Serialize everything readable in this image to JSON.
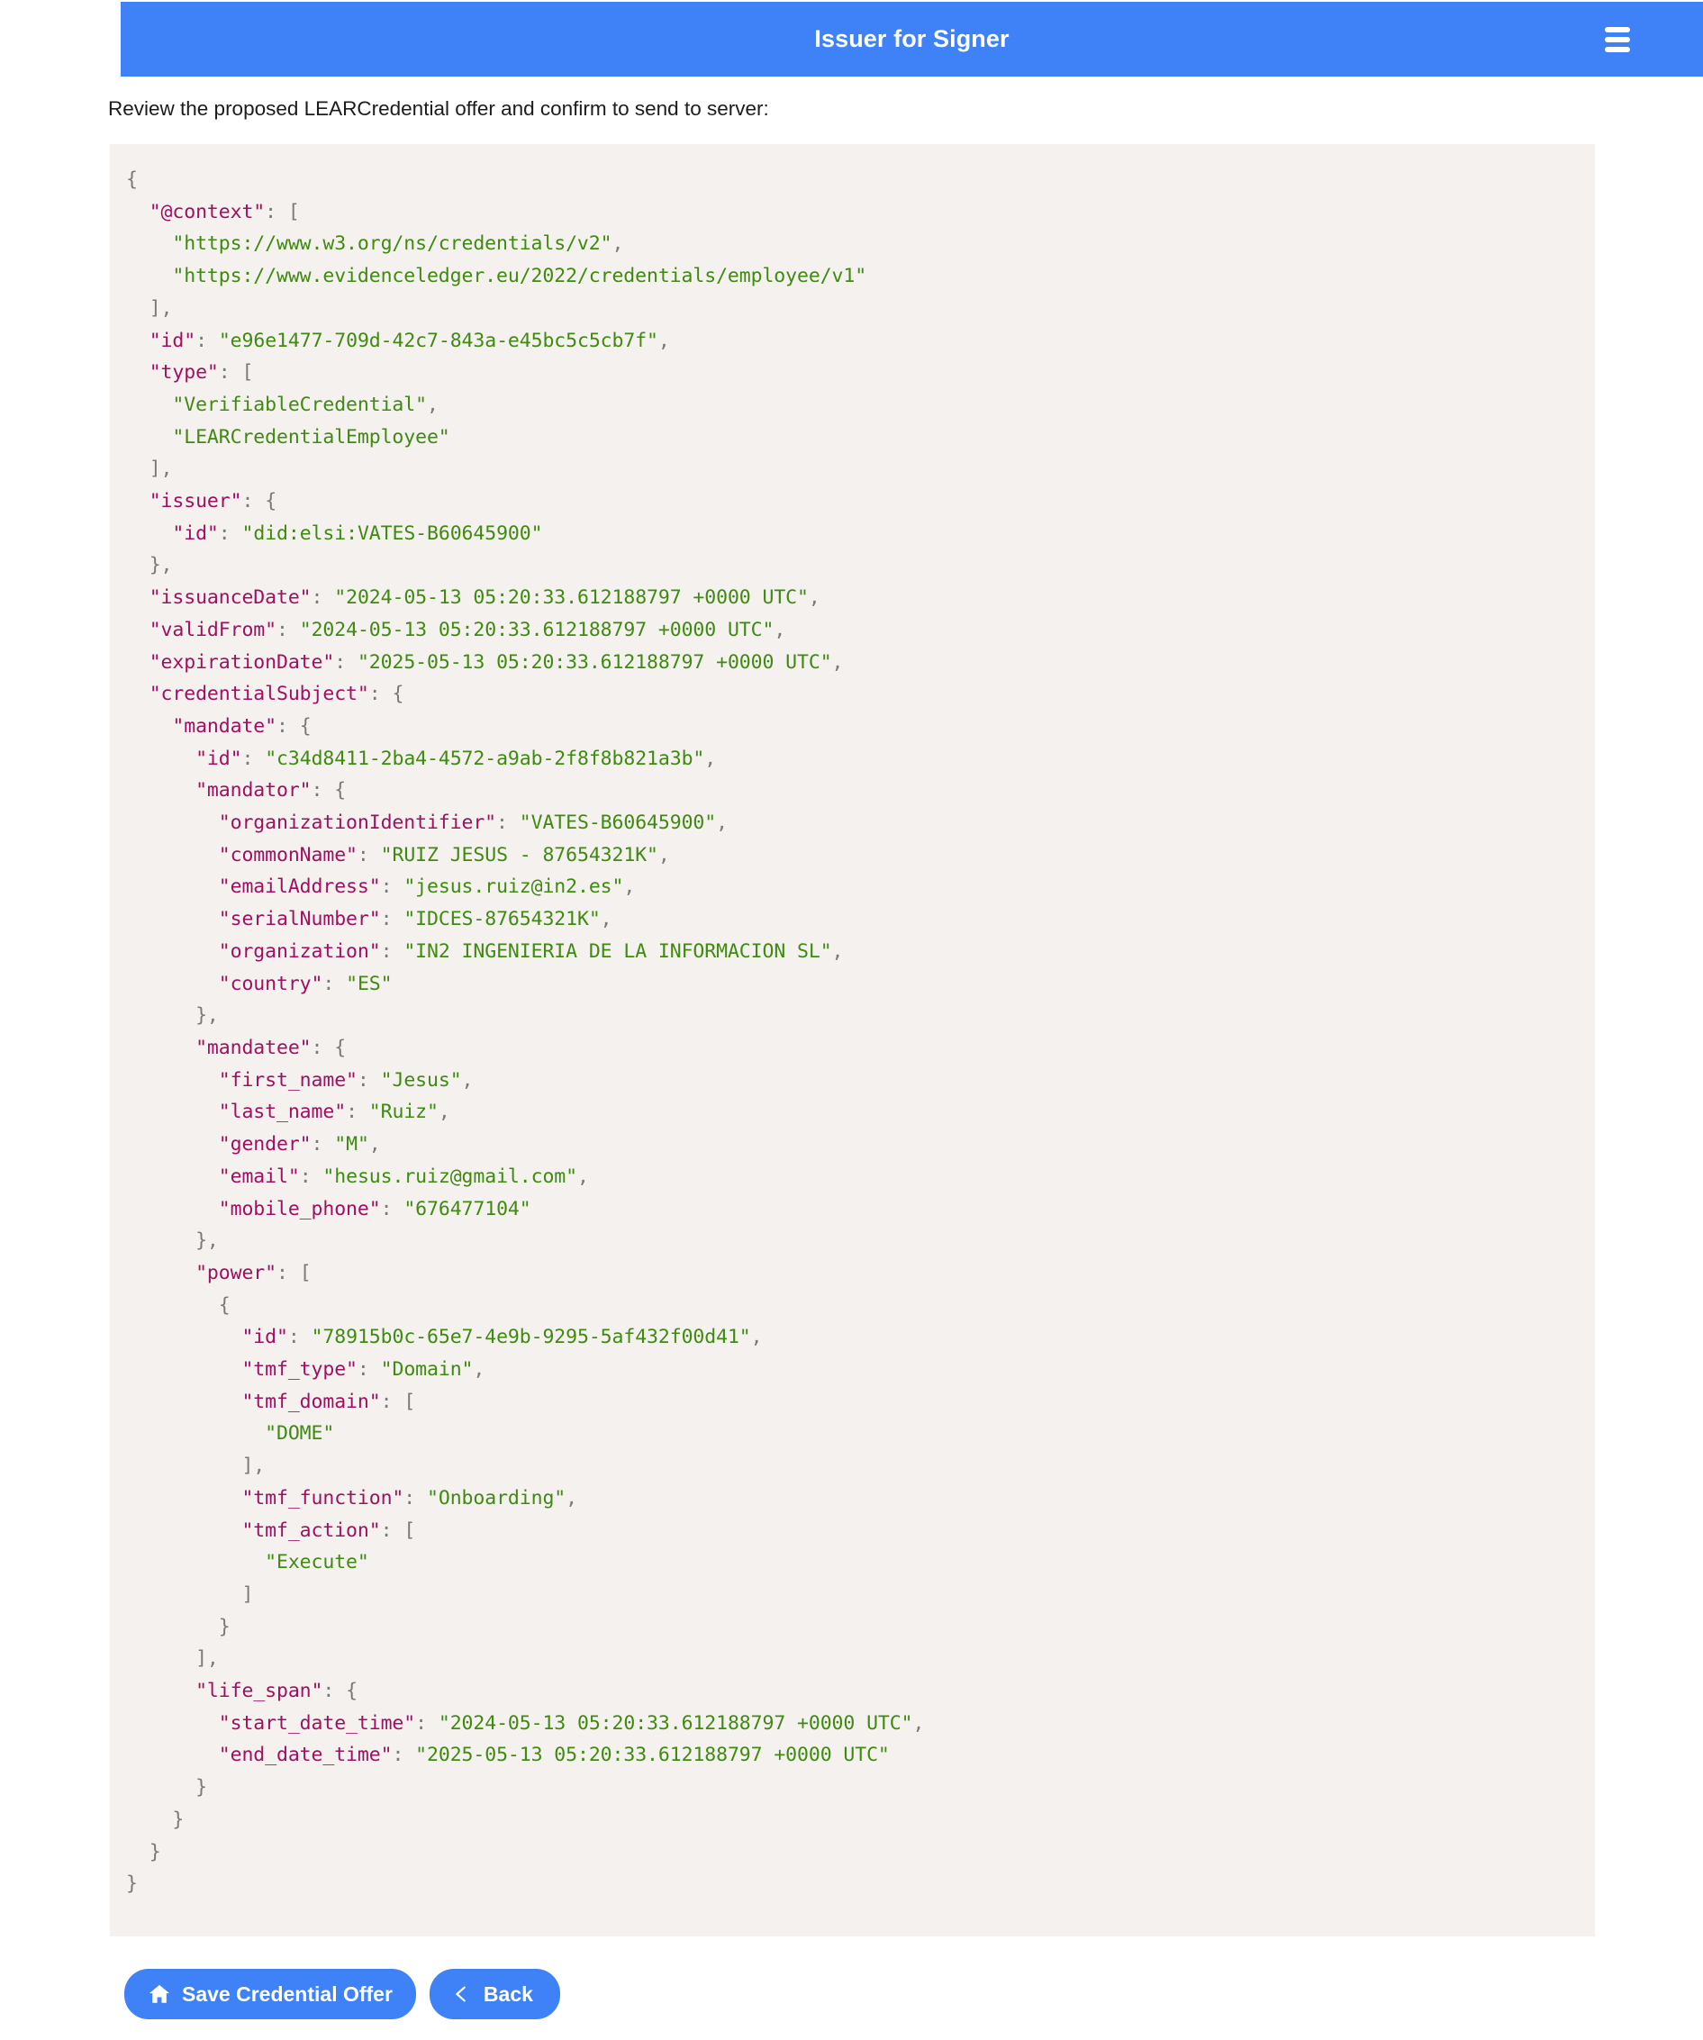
{
  "header": {
    "title": "Issuer for Signer",
    "menu_icon": "hamburger-menu-icon",
    "background_color": "#3f81f6"
  },
  "main": {
    "instruction": "Review the proposed LEARCredential offer and confirm to send to server:",
    "code_panel_background": "#f4f1ee",
    "syntax_colors": {
      "key": "#a01060",
      "string": "#3f8a10",
      "punctuation": "#7a7a7a"
    },
    "credential_json": {
      "@context": [
        "https://www.w3.org/ns/credentials/v2",
        "https://www.evidenceledger.eu/2022/credentials/employee/v1"
      ],
      "id": "e96e1477-709d-42c7-843a-e45bc5c5cb7f",
      "type": [
        "VerifiableCredential",
        "LEARCredentialEmployee"
      ],
      "issuer": {
        "id": "did:elsi:VATES-B60645900"
      },
      "issuanceDate": "2024-05-13 05:20:33.612188797 +0000 UTC",
      "validFrom": "2024-05-13 05:20:33.612188797 +0000 UTC",
      "expirationDate": "2025-05-13 05:20:33.612188797 +0000 UTC",
      "credentialSubject": {
        "mandate": {
          "id": "c34d8411-2ba4-4572-a9ab-2f8f8b821a3b",
          "mandator": {
            "organizationIdentifier": "VATES-B60645900",
            "commonName": "RUIZ JESUS - 87654321K",
            "emailAddress": "jesus.ruiz@in2.es",
            "serialNumber": "IDCES-87654321K",
            "organization": "IN2 INGENIERIA DE LA INFORMACION SL",
            "country": "ES"
          },
          "mandatee": {
            "first_name": "Jesus",
            "last_name": "Ruiz",
            "gender": "M",
            "email": "hesus.ruiz@gmail.com",
            "mobile_phone": "676477104"
          },
          "power": [
            {
              "id": "78915b0c-65e7-4e9b-9295-5af432f00d41",
              "tmf_type": "Domain",
              "tmf_domain": [
                "DOME"
              ],
              "tmf_function": "Onboarding",
              "tmf_action": [
                "Execute"
              ]
            }
          ],
          "life_span": {
            "start_date_time": "2024-05-13 05:20:33.612188797 +0000 UTC",
            "end_date_time": "2025-05-13 05:20:33.612188797 +0000 UTC"
          }
        }
      }
    }
  },
  "actions": {
    "save_label": "Save Credential Offer",
    "save_icon": "home-icon",
    "back_label": "Back",
    "back_icon": "chevron-left-icon",
    "button_color": "#3f81f6"
  }
}
